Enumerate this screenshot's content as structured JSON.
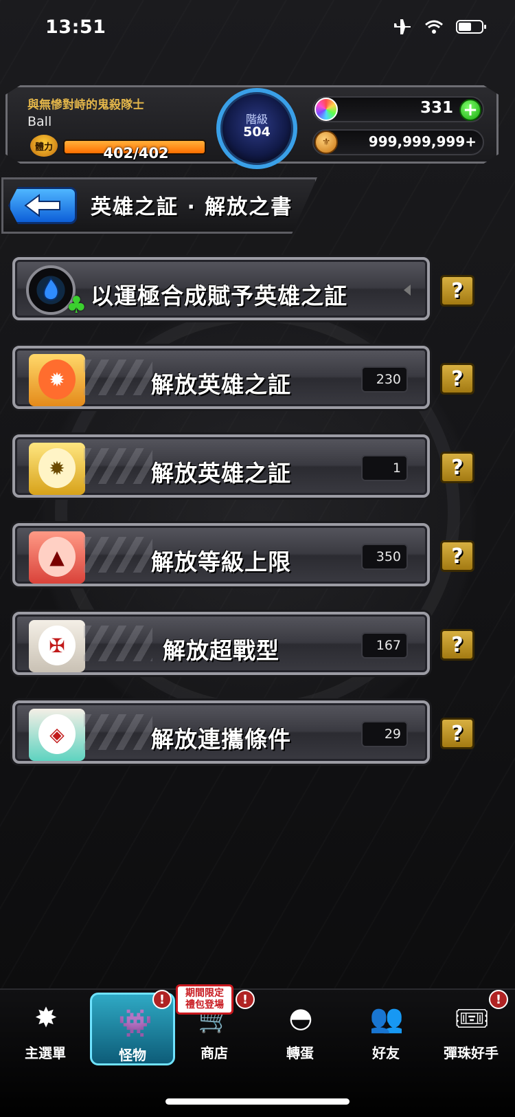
{
  "status_bar": {
    "time": "13:51"
  },
  "header": {
    "subtitle": "與無慘對峙的鬼殺隊士",
    "player_name": "Ball",
    "stamina_label": "體力",
    "stamina_text": "402/402",
    "stamina_fraction": 1.0,
    "rank_label": "階級",
    "rank_value": "504",
    "orbs": "331",
    "coins": "999,999,999+"
  },
  "title_bar": {
    "title": "英雄之証 · 解放之書"
  },
  "rows": [
    {
      "label": "以運極合成賦予英雄之証",
      "count": ""
    },
    {
      "label": "解放英雄之証",
      "count": "230"
    },
    {
      "label": "解放英雄之証",
      "count": "1"
    },
    {
      "label": "解放等級上限",
      "count": "350"
    },
    {
      "label": "解放超戰型",
      "count": "167"
    },
    {
      "label": "解放連攜條件",
      "count": "29"
    }
  ],
  "help_label": "?",
  "bottom_nav": {
    "promo_tag": "期間限定\n禮包登場",
    "items": [
      {
        "label": "主選單"
      },
      {
        "label": "怪物"
      },
      {
        "label": "商店"
      },
      {
        "label": "轉蛋"
      },
      {
        "label": "好友"
      },
      {
        "label": "彈珠好手"
      }
    ],
    "alert_glyph": "!"
  },
  "colors": {
    "accent_blue": "#3aa0e8",
    "help_gold": "#d8b041",
    "stamina_orange": "#ff6f00",
    "alert_red": "#b02323"
  }
}
